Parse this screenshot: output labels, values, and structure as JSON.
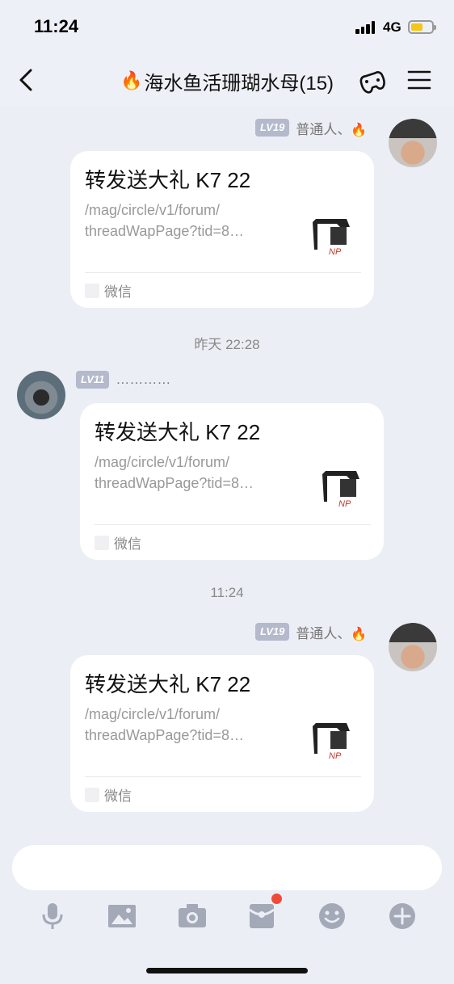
{
  "status_bar": {
    "time": "11:24",
    "network": "4G",
    "battery_level": 0.6
  },
  "nav": {
    "title_emoji": "🔥",
    "title": "海水鱼活珊瑚水母(15)"
  },
  "messages": [
    {
      "side": "right",
      "level": "LV19",
      "name": "普通人、",
      "name_emoji": "🔥",
      "card": {
        "title": "转发送大礼 K7 22",
        "desc_line1": "/mag/circle/v1/forum/",
        "desc_line2": "threadWapPage?tid=8…",
        "source": "微信"
      }
    },
    {
      "timestamp": "昨天 22:28"
    },
    {
      "side": "left",
      "level": "LV11",
      "name": "…………",
      "card": {
        "title": "转发送大礼 K7 22",
        "desc_line1": "/mag/circle/v1/forum/",
        "desc_line2": "threadWapPage?tid=8…",
        "source": "微信"
      }
    },
    {
      "timestamp": "11:24"
    },
    {
      "side": "right",
      "level": "LV19",
      "name": "普通人、",
      "name_emoji": "🔥",
      "card": {
        "title": "转发送大礼 K7 22",
        "desc_line1": "/mag/circle/v1/forum/",
        "desc_line2": "threadWapPage?tid=8…",
        "source": "微信"
      }
    }
  ],
  "input": {
    "value": "",
    "placeholder": ""
  },
  "toolbar": [
    "microphone-icon",
    "image-icon",
    "camera-icon",
    "red-packet-icon",
    "emoji-icon",
    "plus-icon"
  ],
  "colors": {
    "background": "#eceef5",
    "badge": "#b4b9cc",
    "notify": "#f04a3a",
    "battery": "#f5c518"
  }
}
